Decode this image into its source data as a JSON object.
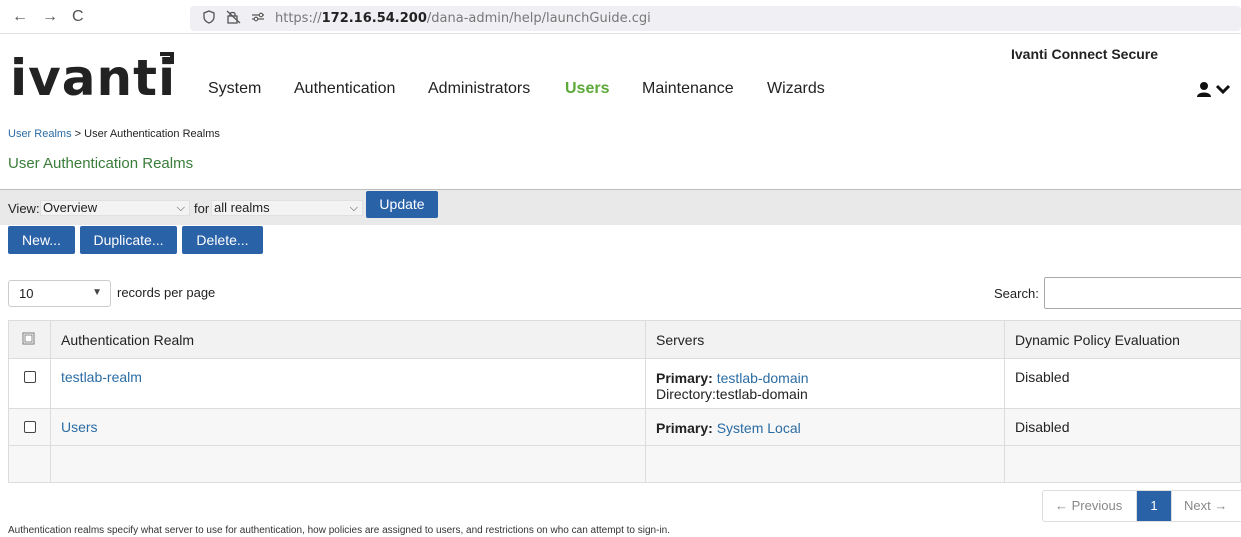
{
  "browser": {
    "url_prefix": "https://",
    "url_host": "172.16.54.200",
    "url_path": "/dana-admin/help/launchGuide.cgi"
  },
  "header": {
    "logo_text": "ivanti",
    "product_name": "Ivanti Connect Secure",
    "nav": [
      "System",
      "Authentication",
      "Administrators",
      "Users",
      "Maintenance",
      "Wizards"
    ],
    "active_nav": "Users"
  },
  "breadcrumb": {
    "parent": "User Realms",
    "separator": ">",
    "current": "User Authentication Realms"
  },
  "page_title": "User Authentication Realms",
  "viewbar": {
    "view_label": "View:",
    "view_value": "Overview",
    "for_label": "for",
    "realms_value": "all realms",
    "update_label": "Update"
  },
  "actions": {
    "new_label": "New...",
    "duplicate_label": "Duplicate...",
    "delete_label": "Delete..."
  },
  "records": {
    "per_page_value": "10",
    "per_page_label": "records per page",
    "search_label": "Search:"
  },
  "table": {
    "headers": [
      "Authentication Realm",
      "Servers",
      "Dynamic Policy Evaluation"
    ],
    "rows": [
      {
        "realm": "testlab-realm",
        "primary_label": "Primary:",
        "primary_value": "testlab-domain",
        "directory": "Directory:testlab-domain",
        "dynamic": "Disabled"
      },
      {
        "realm": "Users",
        "primary_label": "Primary:",
        "primary_value": "System Local",
        "directory": "",
        "dynamic": "Disabled"
      }
    ]
  },
  "pager": {
    "previous": "← Previous",
    "current": "1",
    "next": "Next →"
  },
  "footer": "Authentication realms specify what server to use for authentication, how policies are assigned to users, and restrictions on who can attempt to sign-in."
}
